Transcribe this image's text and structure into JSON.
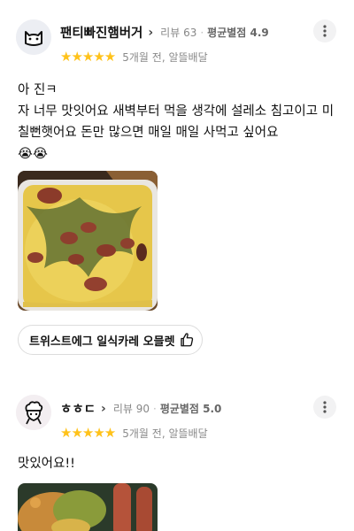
{
  "reviews": [
    {
      "nickname": "팬티빠진햄버거",
      "review_count": "리뷰 63",
      "avg_rating": "평균별점 4.9",
      "stars": "★★★★★",
      "rating": 5,
      "time_and_type": "5개월 전, 알뜰배달",
      "text_line1": "아 진ㅋ",
      "text_line2": "자 너무 맛잇어요 새벽부터 먹을 생각에 설레소 침고이고 미칠뻔햇어요 돈만 많으면 매일 매일 사먹고 싶어요",
      "emojis": "😭😭",
      "menu_item": "트위스트에그 일식카레 오믈렛"
    },
    {
      "nickname": "ㅎㅎㄷ",
      "review_count": "리뷰 90",
      "avg_rating": "평균별점 5.0",
      "stars": "★★★★★",
      "rating": 5,
      "time_and_type": "5개월 전, 알뜰배달",
      "text_line1": "맛있어요!!"
    }
  ],
  "colors": {
    "star": "#ffc21a",
    "text": "#111111",
    "meta": "#888888"
  }
}
